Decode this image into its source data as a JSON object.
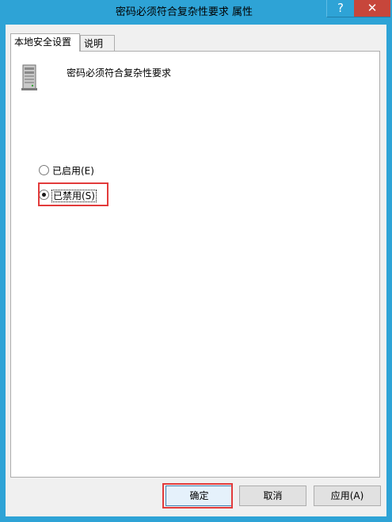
{
  "window": {
    "title": "密码必须符合复杂性要求 属性",
    "help_glyph": "?",
    "close_glyph": "✕"
  },
  "tabs": [
    {
      "label": "本地安全设置",
      "active": true
    },
    {
      "label": "说明",
      "active": false
    }
  ],
  "policy": {
    "icon": "server-icon",
    "name": "密码必须符合复杂性要求"
  },
  "options": [
    {
      "label": "已启用(E)",
      "checked": false
    },
    {
      "label": "已禁用(S)",
      "checked": true
    }
  ],
  "buttons": {
    "ok": "确定",
    "cancel": "取消",
    "apply": "应用(A)"
  },
  "colors": {
    "title_bar": "#2ea3d6",
    "close_button": "#c7463b",
    "highlight": "#e23b3b"
  }
}
